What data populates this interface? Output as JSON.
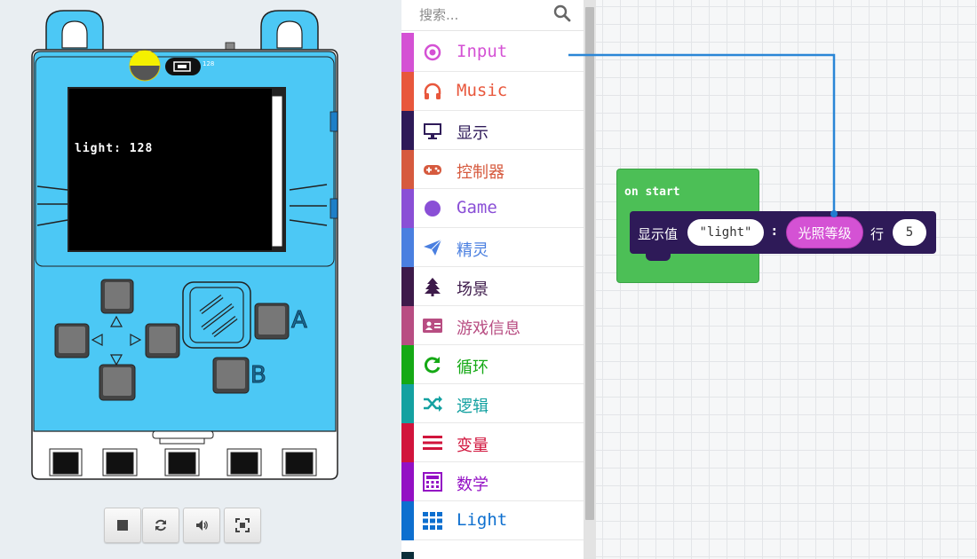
{
  "simulator": {
    "screen_text": "light: 128",
    "light_indicator_value": "128",
    "buttons": {
      "a": "A",
      "b": "B"
    },
    "controls": [
      {
        "name": "stop-button",
        "icon": "stop-icon"
      },
      {
        "name": "restart-button",
        "icon": "refresh-icon"
      },
      {
        "name": "mute-button",
        "icon": "speaker-icon"
      },
      {
        "name": "fullscreen-button",
        "icon": "fullscreen-icon"
      }
    ]
  },
  "toolbox": {
    "search_placeholder": "搜索...",
    "categories": [
      {
        "label": "Input",
        "color": "#d451d4",
        "icon": "target-icon"
      },
      {
        "label": "Music",
        "color": "#e8573c",
        "icon": "headphones-icon"
      },
      {
        "label": "显示",
        "color": "#2e1a58",
        "icon": "monitor-icon"
      },
      {
        "label": "控制器",
        "color": "#d65a3e",
        "icon": "gamepad-icon"
      },
      {
        "label": "Game",
        "color": "#8a4fd6",
        "icon": "circle-icon"
      },
      {
        "label": "精灵",
        "color": "#4a7fe0",
        "icon": "paper-plane-icon"
      },
      {
        "label": "场景",
        "color": "#3d1a4a",
        "icon": "tree-icon"
      },
      {
        "label": "游戏信息",
        "color": "#b84d82",
        "icon": "id-card-icon"
      },
      {
        "label": "循环",
        "color": "#15a915",
        "icon": "loop-icon"
      },
      {
        "label": "逻辑",
        "color": "#14a1a1",
        "icon": "shuffle-icon"
      },
      {
        "label": "变量",
        "color": "#d1143c",
        "icon": "list-icon"
      },
      {
        "label": "数学",
        "color": "#9310c4",
        "icon": "calculator-icon"
      },
      {
        "label": "Light",
        "color": "#0d6fcf",
        "icon": "grid-icon"
      }
    ]
  },
  "workspace": {
    "on_start": "on start",
    "show_label": "显示值",
    "string_value": "\"light\"",
    "colon": ":",
    "light_level": "光照等级",
    "row_label": "行",
    "row_value": "5"
  }
}
